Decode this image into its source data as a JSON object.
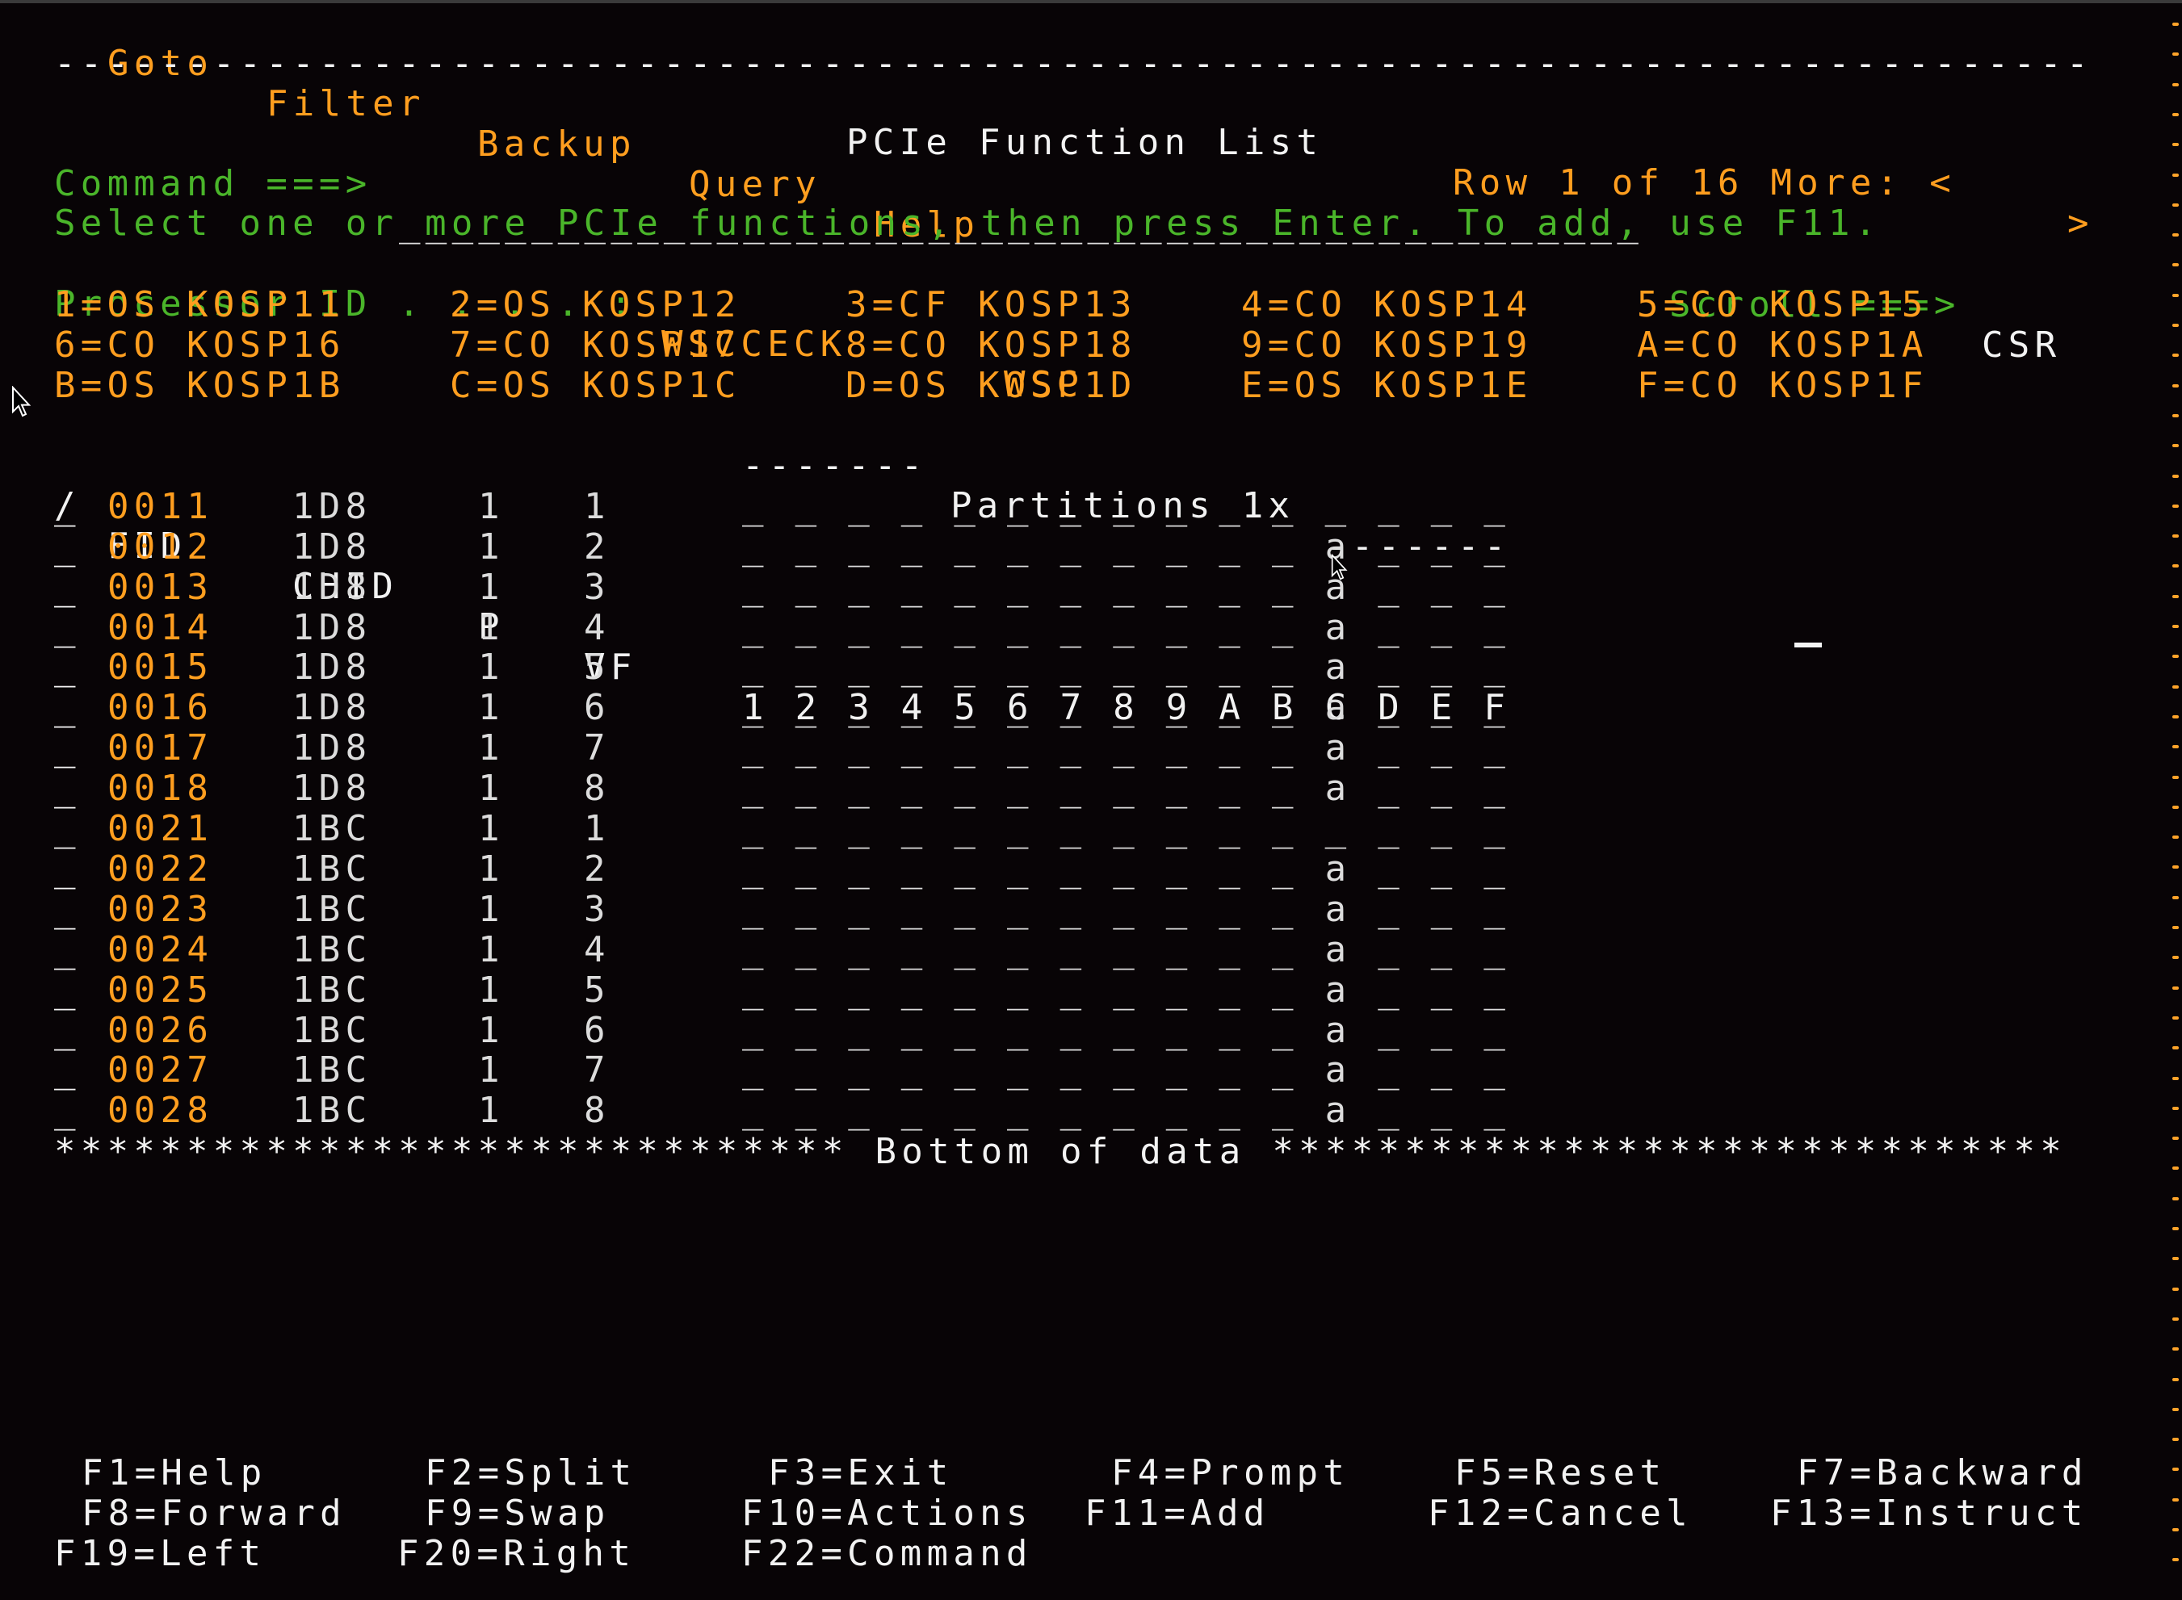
{
  "menu_bar": {
    "items": [
      "Goto",
      "Filter",
      "Backup",
      "Query",
      "Help"
    ]
  },
  "separator": "-----------------------------------------------------------------------------",
  "header": {
    "title": "PCIe Function List",
    "row_info": "Row 1 of 16 More: <",
    "more_right": ">",
    "command_label": "Command ===>",
    "command_value": "",
    "command_placeholder": "_______________________________________________",
    "scroll_label": "Scroll ===>",
    "scroll_value": "CSR"
  },
  "instructions": "Select one or more PCIe functions, then press Enter. To add, use F11.",
  "processor": {
    "label": "Processor ID . . . . :",
    "id": "WSCCECK",
    "name": "WSC"
  },
  "partitions_legend": [
    [
      "1=OS KOSP11",
      "2=OS KOSP12",
      "3=CF KOSP13",
      "4=CO KOSP14",
      "5=CO KOSP15"
    ],
    [
      "6=CO KOSP16",
      "7=CO KOSP17",
      "8=CO KOSP18",
      "9=CO KOSP19",
      "A=CO KOSP1A"
    ],
    [
      "B=OS KOSP1B",
      "C=OS KOSP1C",
      "D=OS KOSP1D",
      "E=OS KOSP1E",
      "F=CO KOSP1F"
    ]
  ],
  "partitions_header": {
    "left_dashes": "-------",
    "label": "Partitions 1x",
    "right_dashes": "-------"
  },
  "table": {
    "columns": {
      "select": "/",
      "fid": "FID",
      "chid": "CHID",
      "p": "P",
      "vf": "VF",
      "partitions": [
        "1",
        "2",
        "3",
        "4",
        "5",
        "6",
        "7",
        "8",
        "9",
        "A",
        "B",
        "C",
        "D",
        "E",
        "F"
      ]
    },
    "rows": [
      {
        "sel": "_",
        "fid": "0011",
        "chid": "1D8",
        "p": "1",
        "vf": "1",
        "parts": "_ _ _ _ _ _ _ _ _ _ _ _ _ _ _"
      },
      {
        "sel": "_",
        "fid": "0012",
        "chid": "1D8",
        "p": "1",
        "vf": "2",
        "parts": "_ _ _ _ _ _ _ _ _ _ _ a _ _ _"
      },
      {
        "sel": "_",
        "fid": "0013",
        "chid": "1D8",
        "p": "1",
        "vf": "3",
        "parts": "_ _ _ _ _ _ _ _ _ _ _ a _ _ _"
      },
      {
        "sel": "_",
        "fid": "0014",
        "chid": "1D8",
        "p": "1",
        "vf": "4",
        "parts": "_ _ _ _ _ _ _ _ _ _ _ a _ _ _"
      },
      {
        "sel": "_",
        "fid": "0015",
        "chid": "1D8",
        "p": "1",
        "vf": "5",
        "parts": "_ _ _ _ _ _ _ _ _ _ _ a _ _ _"
      },
      {
        "sel": "_",
        "fid": "0016",
        "chid": "1D8",
        "p": "1",
        "vf": "6",
        "parts": "_ _ _ _ _ _ _ _ _ _ _ a _ _ _"
      },
      {
        "sel": "_",
        "fid": "0017",
        "chid": "1D8",
        "p": "1",
        "vf": "7",
        "parts": "_ _ _ _ _ _ _ _ _ _ _ a _ _ _"
      },
      {
        "sel": "_",
        "fid": "0018",
        "chid": "1D8",
        "p": "1",
        "vf": "8",
        "parts": "_ _ _ _ _ _ _ _ _ _ _ a _ _ _"
      },
      {
        "sel": "_",
        "fid": "0021",
        "chid": "1BC",
        "p": "1",
        "vf": "1",
        "parts": "_ _ _ _ _ _ _ _ _ _ _ _ _ _ _"
      },
      {
        "sel": "_",
        "fid": "0022",
        "chid": "1BC",
        "p": "1",
        "vf": "2",
        "parts": "_ _ _ _ _ _ _ _ _ _ _ a _ _ _"
      },
      {
        "sel": "_",
        "fid": "0023",
        "chid": "1BC",
        "p": "1",
        "vf": "3",
        "parts": "_ _ _ _ _ _ _ _ _ _ _ a _ _ _"
      },
      {
        "sel": "_",
        "fid": "0024",
        "chid": "1BC",
        "p": "1",
        "vf": "4",
        "parts": "_ _ _ _ _ _ _ _ _ _ _ a _ _ _"
      },
      {
        "sel": "_",
        "fid": "0025",
        "chid": "1BC",
        "p": "1",
        "vf": "5",
        "parts": "_ _ _ _ _ _ _ _ _ _ _ a _ _ _"
      },
      {
        "sel": "_",
        "fid": "0026",
        "chid": "1BC",
        "p": "1",
        "vf": "6",
        "parts": "_ _ _ _ _ _ _ _ _ _ _ a _ _ _"
      },
      {
        "sel": "_",
        "fid": "0027",
        "chid": "1BC",
        "p": "1",
        "vf": "7",
        "parts": "_ _ _ _ _ _ _ _ _ _ _ a _ _ _"
      },
      {
        "sel": "_",
        "fid": "0028",
        "chid": "1BC",
        "p": "1",
        "vf": "8",
        "parts": "_ _ _ _ _ _ _ _ _ _ _ a _ _ _"
      }
    ]
  },
  "bottom_marker": "****************************** Bottom of data ******************************",
  "function_keys": [
    [
      "F1=Help",
      "F2=Split",
      "F3=Exit",
      "F4=Prompt",
      "F5=Reset",
      "F7=Backward"
    ],
    [
      "F8=Forward",
      "F9=Swap",
      "F10=Actions",
      "F11=Add",
      "F12=Cancel",
      "F13=Instruct"
    ],
    [
      "F19=Left",
      "F20=Right",
      "F22=Command"
    ]
  ],
  "icons": {
    "mouse_pointer": "arrow-cursor-icon",
    "text_cursor": "text-cursor-icon"
  },
  "colors": {
    "background": "#080406",
    "orange": "#ff9e1f",
    "green": "#4ab52a",
    "white": "#f2f2f2"
  }
}
